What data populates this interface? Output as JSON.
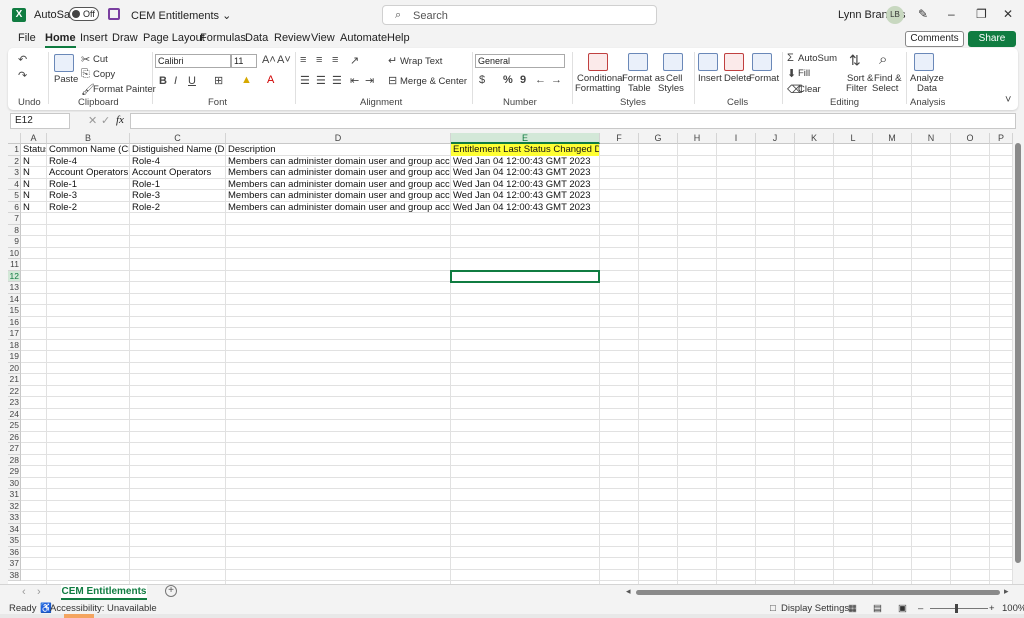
{
  "titlebar": {
    "autosave_label": "AutoSave",
    "autosave_state": "Off",
    "doc_title": "CEM Entitlements ⌄",
    "search_placeholder": "Search",
    "user_name": "Lynn Brandus",
    "user_initials": "LB"
  },
  "menu": {
    "items": [
      "File",
      "Home",
      "Insert",
      "Draw",
      "Page Layout",
      "Formulas",
      "Data",
      "Review",
      "View",
      "Automate",
      "Help"
    ],
    "active": "Home",
    "comments_label": "Comments",
    "share_label": "Share"
  },
  "ribbon": {
    "undo_group": "Undo",
    "clipboard": {
      "paste": "Paste",
      "cut": "Cut",
      "copy": "Copy",
      "format_painter": "Format Painter",
      "group": "Clipboard"
    },
    "font": {
      "name": "Calibri",
      "size": "11",
      "bold": "B",
      "italic": "I",
      "underline": "U",
      "group": "Font"
    },
    "alignment": {
      "wrap_text": "Wrap Text",
      "merge_center": "Merge & Center",
      "group": "Alignment"
    },
    "number": {
      "format": "General",
      "currency": "$",
      "percent": "%",
      "comma": "9",
      "group": "Number"
    },
    "styles": {
      "conditional_1": "Conditional",
      "conditional_2": "Formatting",
      "format_table_1": "Format as",
      "format_table_2": "Table",
      "cell_styles_1": "Cell",
      "cell_styles_2": "Styles",
      "group": "Styles"
    },
    "cells": {
      "insert": "Insert",
      "delete": "Delete",
      "format": "Format",
      "group": "Cells"
    },
    "editing": {
      "autosum": "AutoSum",
      "fill": "Fill",
      "clear": "Clear",
      "sort_1": "Sort &",
      "sort_2": "Filter",
      "find_1": "Find &",
      "find_2": "Select",
      "group": "Editing"
    },
    "analysis": {
      "analyze_1": "Analyze",
      "analyze_2": "Data",
      "group": "Analysis"
    }
  },
  "formula_bar": {
    "name_box": "E12",
    "fx": "fx",
    "content": ""
  },
  "sheet": {
    "columns": [
      "A",
      "B",
      "C",
      "D",
      "E",
      "F",
      "G",
      "H",
      "I",
      "J",
      "K",
      "L",
      "M",
      "N",
      "O",
      "P"
    ],
    "header": [
      "Status",
      "Common Name (CN)",
      "Distiguished Name (DN)",
      "Description",
      "Entitlement Last Status Changed Date"
    ],
    "rows": [
      [
        "N",
        "Role-4",
        "Role-4",
        "Members can administer domain user and group accounts",
        "Wed Jan 04 12:00:43 GMT 2023"
      ],
      [
        "N",
        "Account Operators",
        "Account Operators",
        "Members can administer domain user and group accounts",
        "Wed Jan 04 12:00:43 GMT 2023"
      ],
      [
        "N",
        "Role-1",
        "Role-1",
        "Members can administer domain user and group accounts",
        "Wed Jan 04 12:00:43 GMT 2023"
      ],
      [
        "N",
        "Role-3",
        "Role-3",
        "Members can administer domain user and group accounts",
        "Wed Jan 04 12:00:43 GMT 2023"
      ],
      [
        "N",
        "Role-2",
        "Role-2",
        "Members can administer domain user and group accounts",
        "Wed Jan 04 12:00:43 GMT 2023"
      ]
    ],
    "row_count": 38,
    "selected_cell": "E12",
    "highlight_color": "#ffff33",
    "accent_color": "#107c41"
  },
  "sheet_tabs": {
    "active": "CEM Entitlements"
  },
  "status": {
    "ready": "Ready",
    "accessibility": "Accessibility: Unavailable",
    "display_settings": "Display Settings",
    "zoom": "100%"
  }
}
